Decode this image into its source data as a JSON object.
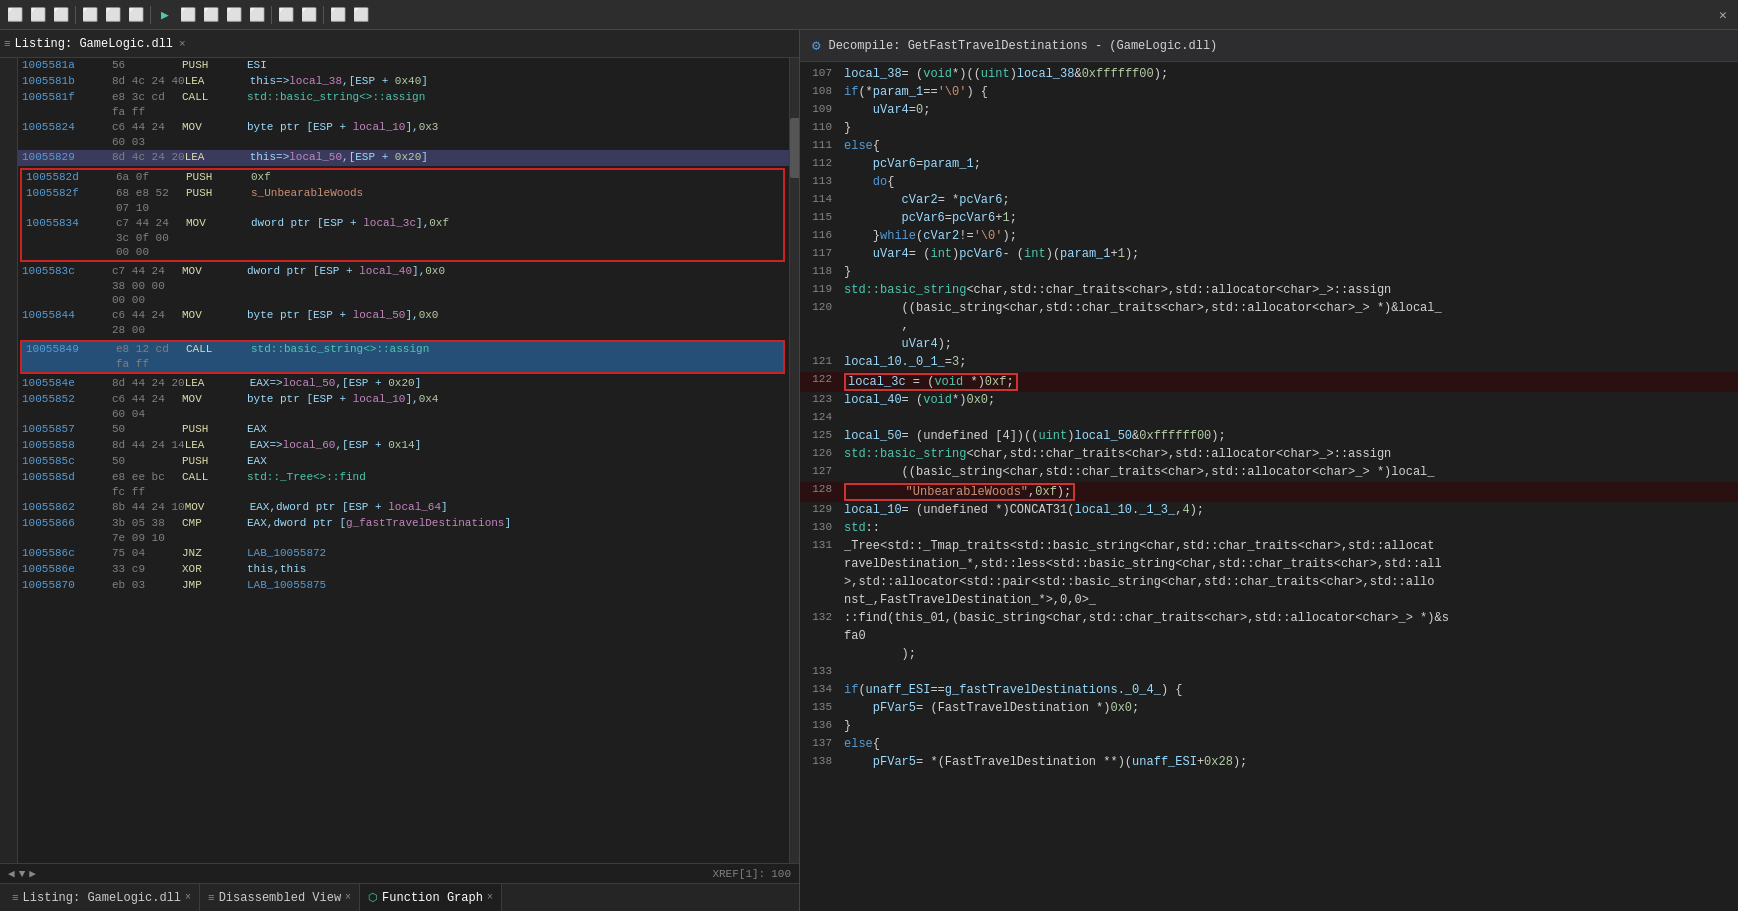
{
  "toolbar": {
    "icons": [
      "⬛",
      "⬛",
      "⬛",
      "⬛",
      "⬛",
      "⬛",
      "⬛",
      "⬛",
      "⬛",
      "⬛",
      "⬛",
      "⬛",
      "⬛",
      "⬛",
      "⬛",
      "⬛",
      "⬛",
      "⬛",
      "⬛"
    ]
  },
  "left_panel": {
    "title": "Listing: GameLogic.dll",
    "tab_icon": "≡",
    "close_label": "×",
    "lines": [
      {
        "addr": "1005581a",
        "bytes": "56",
        "mnem": "PUSH",
        "operand": "ESI",
        "type": "normal"
      },
      {
        "addr": "1005581b",
        "bytes": "8d 4c 24 40",
        "mnem": "LEA",
        "operand": "this=>local_38,[ESP + 0x40]",
        "type": "normal"
      },
      {
        "addr": "1005581f",
        "bytes": "e8 3c cd",
        "mnem": "CALL",
        "operand": "std::basic_string<>::assign",
        "type": "normal",
        "extra": "fa ff"
      },
      {
        "addr": "10055824",
        "bytes": "c6 44 24",
        "mnem": "MOV",
        "operand": "byte ptr [ESP + local_10],0x3",
        "type": "normal",
        "extra": "60 03"
      },
      {
        "addr": "10055829",
        "bytes": "8d 4c 24 20",
        "mnem": "LEA",
        "operand": "this=>local_50,[ESP + 0x20]",
        "type": "normal"
      },
      {
        "addr": "1005582d",
        "bytes": "6a 0f",
        "mnem": "PUSH",
        "operand": "0xf",
        "type": "redbox"
      },
      {
        "addr": "1005582f",
        "bytes": "68 e8 52",
        "mnem": "PUSH",
        "operand": "s_UnbearableWoods",
        "type": "redbox",
        "extra": "07 10"
      },
      {
        "addr": "10055834",
        "bytes": "c7 44 24",
        "mnem": "MOV",
        "operand": "dword ptr [ESP + local_3c],0xf",
        "type": "redbox",
        "extra": "3c 0f 00\n00 00"
      },
      {
        "addr": "1005583c",
        "bytes": "c7 44 24",
        "mnem": "MOV",
        "operand": "dword ptr [ESP + local_40],0x0",
        "type": "normal",
        "extra": "38 00 00\n00 00"
      },
      {
        "addr": "10055844",
        "bytes": "c6 44 24",
        "mnem": "MOV",
        "operand": "byte ptr [ESP + local_50],0x0",
        "type": "normal",
        "extra": "28 00"
      },
      {
        "addr": "10055849",
        "bytes": "e8 12 cd",
        "mnem": "CALL",
        "operand": "std::basic_string<>::assign",
        "type": "selected",
        "extra": "fa ff"
      },
      {
        "addr": "1005584e",
        "bytes": "8d 44 24 20",
        "mnem": "LEA",
        "operand": "EAX=>local_50,[ESP + 0x20]",
        "type": "normal"
      },
      {
        "addr": "10055852",
        "bytes": "c6 44 24",
        "mnem": "MOV",
        "operand": "byte ptr [ESP + local_10],0x4",
        "type": "normal",
        "extra": "60 04"
      },
      {
        "addr": "10055857",
        "bytes": "50",
        "mnem": "PUSH",
        "operand": "EAX",
        "type": "normal"
      },
      {
        "addr": "10055858",
        "bytes": "8d 44 24 14",
        "mnem": "LEA",
        "operand": "EAX=>local_60,[ESP + 0x14]",
        "type": "normal"
      },
      {
        "addr": "1005585c",
        "bytes": "50",
        "mnem": "PUSH",
        "operand": "EAX",
        "type": "normal"
      },
      {
        "addr": "1005585d",
        "bytes": "e8 ee bc",
        "mnem": "CALL",
        "operand": "std::_Tree<>::find",
        "type": "normal",
        "extra": "fc ff"
      },
      {
        "addr": "10055862",
        "bytes": "8b 44 24 10",
        "mnem": "MOV",
        "operand": "EAX,dword ptr [ESP + local_64]",
        "type": "normal"
      },
      {
        "addr": "10055866",
        "bytes": "3b 05 38",
        "mnem": "CMP",
        "operand": "EAX,dword ptr [g_fastTravelDestinations]",
        "type": "normal",
        "extra": "7e 09 10"
      },
      {
        "addr": "1005586c",
        "bytes": "75 04",
        "mnem": "JNZ",
        "operand": "LAB_10055872",
        "type": "normal"
      },
      {
        "addr": "1005586e",
        "bytes": "33 c9",
        "mnem": "XOR",
        "operand": "this,this",
        "type": "normal"
      },
      {
        "addr": "10055870",
        "bytes": "eb 03",
        "mnem": "JMP",
        "operand": "LAB_10055875",
        "type": "normal"
      }
    ],
    "bottom_label": "LAB_10055872"
  },
  "right_panel": {
    "title": "Decompile: GetFastTravelDestinations - (GameLogic.dll)",
    "icon": "⚙",
    "lines": [
      {
        "num": 107,
        "code": "local_38 = (void *)((uint)local_38 & 0xffffff00);"
      },
      {
        "num": 108,
        "code": "if (*param_1 == '\\0') {"
      },
      {
        "num": 109,
        "code": "    uVar4 = 0;"
      },
      {
        "num": 110,
        "code": "}"
      },
      {
        "num": 111,
        "code": "else {"
      },
      {
        "num": 112,
        "code": "    pcVar6 = param_1;"
      },
      {
        "num": 113,
        "code": "    do {"
      },
      {
        "num": 114,
        "code": "        cVar2 = *pcVar6;"
      },
      {
        "num": 115,
        "code": "        pcVar6 = pcVar6 + 1;"
      },
      {
        "num": 116,
        "code": "    } while (cVar2 != '\\0');"
      },
      {
        "num": 117,
        "code": "    uVar4 = (int)pcVar6 - (int)(param_1 + 1);"
      },
      {
        "num": 118,
        "code": "}"
      },
      {
        "num": 119,
        "code": "std::basic_string<char,std::char_traits<char>,std::allocator<char>_>::assign"
      },
      {
        "num": 120,
        "code": "        ((basic_string<char,std::char_traits<char>,std::allocator<char>_> *)&local_"
      },
      {
        "num": 120,
        "code": "        ,"
      },
      {
        "num": 120,
        "code": "        uVar4);"
      },
      {
        "num": 121,
        "code": "local_10._0_1_ = 3;"
      },
      {
        "num": 122,
        "code": "local_3c = (void *)0xf;",
        "highlight": "red"
      },
      {
        "num": 123,
        "code": "local_40 = (void *)0x0;"
      },
      {
        "num": 124,
        "code": ""
      },
      {
        "num": 125,
        "code": "local_50 = (undefined  [4])((uint)local_50 & 0xffffff00);"
      },
      {
        "num": 126,
        "code": "std::basic_string<char,std::char_traits<char>,std::allocator<char>_>::assign"
      },
      {
        "num": 127,
        "code": "        ((basic_string<char,std::char_traits<char>,std::allocator<char>_> *)local_"
      },
      {
        "num": 128,
        "code": "        \"UnbearableWoods\",0xf);",
        "highlight": "red"
      },
      {
        "num": 129,
        "code": "local_10 = (undefined *)CONCAT31(local_10._1_3_,4);"
      },
      {
        "num": 130,
        "code": "std::"
      },
      {
        "num": 131,
        "code": "_Tree<std::_Tmap_traits<std::basic_string<char,std::char_traits<char>,std::allocat"
      },
      {
        "num": 131,
        "code": "ravelDestination_*,std::less<std::basic_string<char,std::char_traits<char>,std::all"
      },
      {
        "num": 131,
        "code": ">,std::allocator<std::pair<std::basic_string<char,std::char_traits<char>,std::allo"
      },
      {
        "num": 131,
        "code": "nst_,FastTravelDestination_*>,0,0>_"
      },
      {
        "num": 132,
        "code": "::find(this_01,(basic_string<char,std::char_traits<char>,std::allocator<char>_> *)&s"
      },
      {
        "num": 132,
        "code": "fa0"
      },
      {
        "num": 132,
        "code": "        );"
      },
      {
        "num": 133,
        "code": ""
      },
      {
        "num": 134,
        "code": "if (unaff_ESI == g_fastTravelDestinations._0_4_) {"
      },
      {
        "num": 135,
        "code": "    pFVar5 = (FastTravelDestination *)0x0;"
      },
      {
        "num": 136,
        "code": "}"
      },
      {
        "num": 137,
        "code": "else {"
      },
      {
        "num": 138,
        "code": "    pFVar5 = *(FastTravelDestination **)(unaff_ESI + 0x28);"
      }
    ]
  },
  "bottom_tabs": {
    "items": [
      {
        "label": "Listing: GameLogic.dll",
        "icon": "≡",
        "active": false,
        "closable": true
      },
      {
        "label": "Disassembled View",
        "icon": "≡",
        "active": false,
        "closable": true
      },
      {
        "label": "Function Graph",
        "icon": "⬡",
        "active": true,
        "closable": true
      }
    ]
  },
  "status": {
    "xref": "XREF[1]:",
    "value": "100"
  }
}
